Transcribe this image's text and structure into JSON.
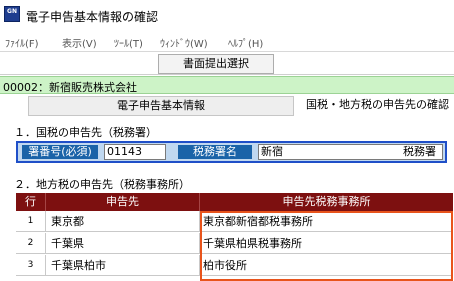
{
  "window": {
    "title": "電子申告基本情報の確認",
    "icon_label": "GN"
  },
  "menu": [
    {
      "label": "ﾌｧｲﾙ(F)"
    },
    {
      "label": "表示(V)"
    },
    {
      "label": "ﾂｰﾙ(T)"
    },
    {
      "label": "ｳｨﾝﾄﾞｳ(W)"
    },
    {
      "label": "ﾍﾙﾌﾟ(H)"
    }
  ],
  "toolbar": {
    "submit_doc_label": "書面提出選択"
  },
  "company": {
    "text": "00002：新宿販売株式会社"
  },
  "tabs": [
    {
      "label": "電子申告基本情報"
    },
    {
      "label": "国税・地方税の申告先の確認"
    }
  ],
  "national": {
    "heading": "１．国税の申告先（税務署）",
    "office_no_label": "署番号(必須)",
    "office_no_value": "01143",
    "office_name_label": "税務署名",
    "office_name_value": "新宿",
    "office_suffix": "税務署"
  },
  "local": {
    "heading": "２．地方税の申告先（税務事務所）",
    "columns": [
      "行",
      "申告先",
      "申告先税務事務所"
    ],
    "rows": [
      {
        "no": "1",
        "destination": "東京都",
        "office": "東京都新宿都税事務所"
      },
      {
        "no": "2",
        "destination": "千葉県",
        "office": "千葉県柏県税事務所"
      },
      {
        "no": "3",
        "destination": "千葉県柏市",
        "office": "柏市役所"
      }
    ]
  },
  "colors": {
    "company_bar": "#cdf3c7",
    "tax_box_border": "#1f4fc8",
    "tax_label_bg": "#1a63a8",
    "grid_header_bg": "#7d1010",
    "highlight_border": "#e8541c"
  }
}
